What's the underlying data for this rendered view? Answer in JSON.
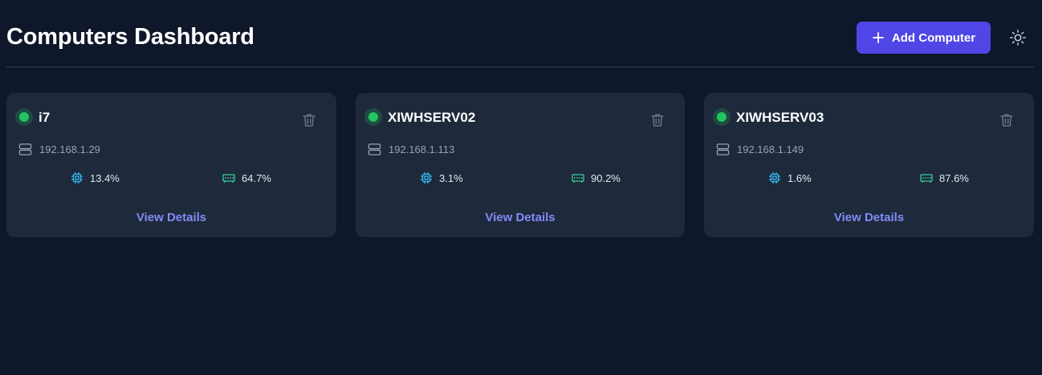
{
  "header": {
    "title": "Computers Dashboard",
    "add_button_label": "Add Computer",
    "add_icon": "plus-icon",
    "theme_icon": "sun-icon"
  },
  "colors": {
    "background": "#0f172a",
    "card": "#1e293b",
    "accent": "#4f46e5",
    "link": "#818cf8",
    "status_online": "#22c55e",
    "cpu_icon": "#38bdf8",
    "memory_icon": "#34d399"
  },
  "computers": [
    {
      "name": "i7",
      "status": "online",
      "ip": "192.168.1.29",
      "cpu": "13.4%",
      "memory": "64.7%",
      "action_label": "View Details"
    },
    {
      "name": "XIWHSERV02",
      "status": "online",
      "ip": "192.168.1.113",
      "cpu": "3.1%",
      "memory": "90.2%",
      "action_label": "View Details"
    },
    {
      "name": "XIWHSERV03",
      "status": "online",
      "ip": "192.168.1.149",
      "cpu": "1.6%",
      "memory": "87.6%",
      "action_label": "View Details"
    }
  ]
}
